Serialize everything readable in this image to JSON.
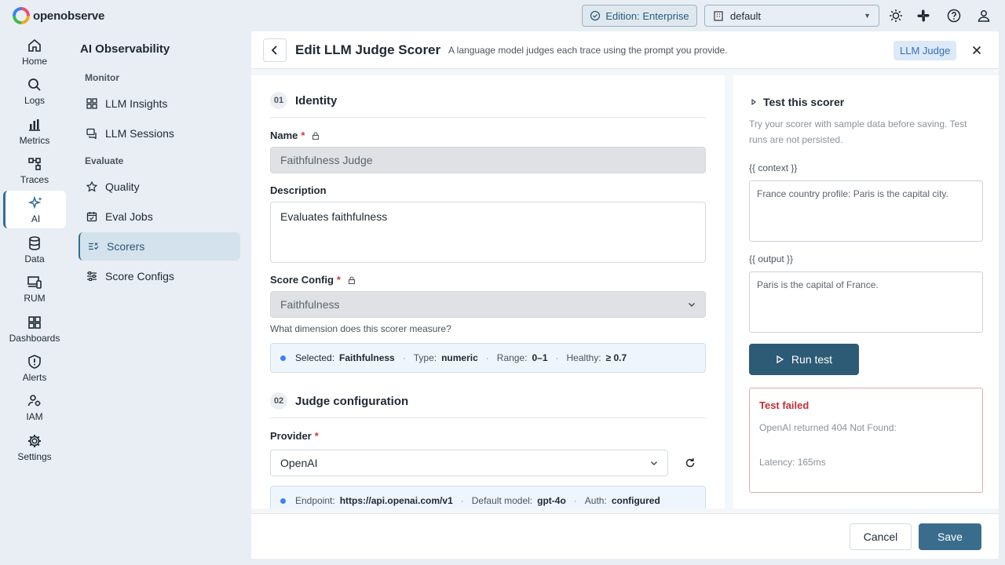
{
  "app": {
    "logo_text": "openobserve"
  },
  "topbar": {
    "edition_label": "Edition: Enterprise",
    "org_value": "default",
    "icons": [
      "sun-icon",
      "slack-icon",
      "help-icon",
      "user-icon"
    ]
  },
  "nav": {
    "items": [
      {
        "label": "Home",
        "icon": "home-icon"
      },
      {
        "label": "Logs",
        "icon": "search-icon"
      },
      {
        "label": "Metrics",
        "icon": "bar-chart-icon"
      },
      {
        "label": "Traces",
        "icon": "traces-icon"
      },
      {
        "label": "AI",
        "icon": "sparkles-icon",
        "active": true
      },
      {
        "label": "Data",
        "icon": "database-icon"
      },
      {
        "label": "RUM",
        "icon": "devices-icon"
      },
      {
        "label": "Dashboards",
        "icon": "dashboard-icon"
      },
      {
        "label": "Alerts",
        "icon": "shield-alert-icon"
      },
      {
        "label": "IAM",
        "icon": "users-icon"
      },
      {
        "label": "Settings",
        "icon": "gear-icon"
      }
    ]
  },
  "sidebar": {
    "title": "AI Observability",
    "group_monitor": "Monitor",
    "group_evaluate": "Evaluate",
    "items": [
      {
        "label": "LLM Insights"
      },
      {
        "label": "LLM Sessions"
      },
      {
        "label": "Quality"
      },
      {
        "label": "Eval Jobs"
      },
      {
        "label": "Scorers",
        "active": true
      },
      {
        "label": "Score Configs"
      }
    ]
  },
  "header": {
    "title": "Edit LLM Judge Scorer",
    "subtitle": "A language model judges each trace using the prompt you provide.",
    "badge": "LLM Judge"
  },
  "form": {
    "section1": {
      "num": "01",
      "title": "Identity"
    },
    "name_label": "Name",
    "name_value": "Faithfulness Judge",
    "desc_label": "Description",
    "desc_value": "Evaluates faithfulness",
    "score_label": "Score Config",
    "score_value": "Faithfulness",
    "score_hint": "What dimension does this scorer measure?",
    "score_info": {
      "selected_label": "Selected:",
      "selected_value": "Faithfulness",
      "type_label": "Type:",
      "type_value": "numeric",
      "range_label": "Range:",
      "range_value": "0–1",
      "healthy_label": "Healthy:",
      "healthy_value": "≥ 0.7"
    },
    "section2": {
      "num": "02",
      "title": "Judge configuration"
    },
    "provider_label": "Provider",
    "provider_value": "OpenAI",
    "provider_info": {
      "endpoint_label": "Endpoint:",
      "endpoint_value": "https://api.openai.com/v1",
      "model_label": "Default model:",
      "model_value": "gpt-4o",
      "auth_label": "Auth:",
      "auth_value": "configured"
    }
  },
  "test": {
    "title": "Test this scorer",
    "description": "Try your scorer with sample data before saving. Test runs are not persisted.",
    "context_label": "{{ context }}",
    "context_value": "France country profile: Paris is the capital city.",
    "output_label": "{{ output }}",
    "output_value": "Paris is the capital of France.",
    "run_label": "Run test",
    "result_title": "Test failed",
    "result_message": "OpenAI returned 404 Not Found:",
    "result_latency": "Latency: 165ms"
  },
  "footer": {
    "cancel_label": "Cancel",
    "save_label": "Save"
  },
  "colors": {
    "accent": "#2d5b75",
    "error": "#c2303b",
    "required": "#d0393d",
    "info": "#3b82f6"
  }
}
